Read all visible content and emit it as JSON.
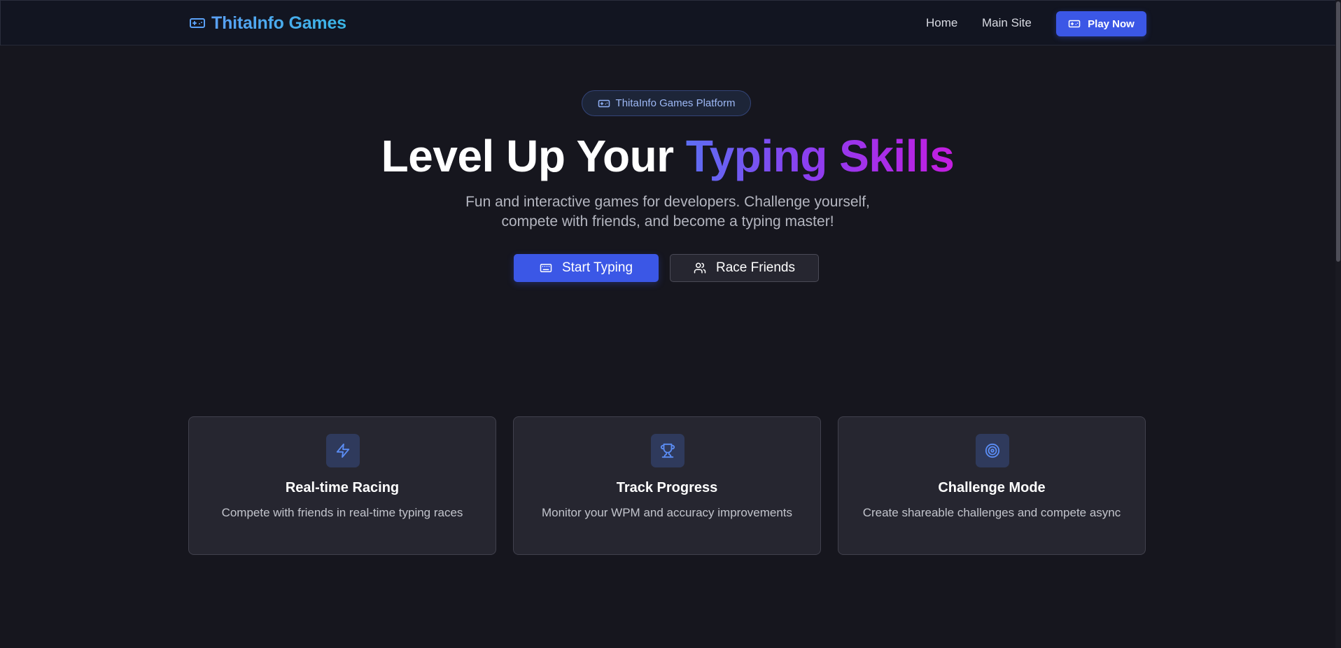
{
  "navbar": {
    "brand_name": "ThitaInfo Games",
    "brand_icon": "gamepad-icon",
    "links": [
      {
        "label": "Home"
      },
      {
        "label": "Main Site"
      }
    ],
    "play_button": {
      "label": "Play Now",
      "icon": "gamepad-icon"
    }
  },
  "hero": {
    "badge": {
      "label": "ThitaInfo Games Platform",
      "icon": "gamepad-icon"
    },
    "title_plain": "Level Up Your ",
    "title_highlight": "Typing Skills",
    "subtitle_line1": "Fun and interactive games for developers. Challenge yourself,",
    "subtitle_line2": "compete with friends, and become a typing master!",
    "primary_button": {
      "label": "Start Typing",
      "icon": "keyboard-icon"
    },
    "secondary_button": {
      "label": "Race Friends",
      "icon": "users-icon"
    }
  },
  "features": [
    {
      "title": "Real-time Racing",
      "description": "Compete with friends in real-time typing races",
      "icon": "lightning-icon"
    },
    {
      "title": "Track Progress",
      "description": "Monitor your WPM and accuracy improvements",
      "icon": "trophy-icon"
    },
    {
      "title": "Challenge Mode",
      "description": "Create shareable challenges and compete async",
      "icon": "target-icon"
    }
  ],
  "colors": {
    "background": "#16161e",
    "navbar": "#121521",
    "accent": "#3b57e6",
    "brand": "#3ea0f0",
    "gradient_start": "#5d6ef2",
    "gradient_end": "#c41de0",
    "card": "#262630",
    "icon_tile": "#2f3a5c"
  }
}
